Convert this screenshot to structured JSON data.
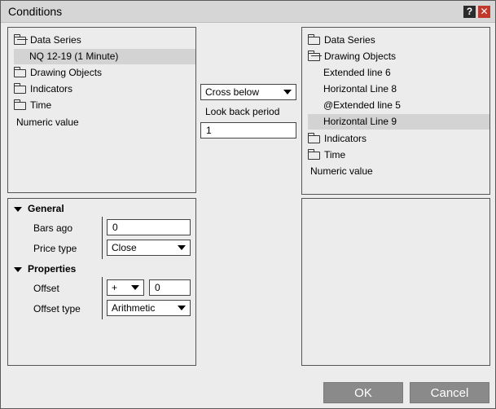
{
  "window": {
    "title": "Conditions",
    "help_label": "?",
    "close_label": "✕"
  },
  "left_tree": {
    "data_series": "Data Series",
    "instrument": "NQ 12-19 (1 Minute)",
    "drawing_objects": "Drawing Objects",
    "indicators": "Indicators",
    "time": "Time",
    "numeric_value": "Numeric value"
  },
  "middle": {
    "operator": "Cross below",
    "lookback_label": "Look back period",
    "lookback_value": "1"
  },
  "right_tree": {
    "data_series": "Data Series",
    "drawing_objects": "Drawing Objects",
    "drawing_children": [
      "Extended line 6",
      "Horizontal Line 8",
      "@Extended line 5",
      "Horizontal Line 9"
    ],
    "selected_child": "Horizontal Line 9",
    "indicators": "Indicators",
    "time": "Time",
    "numeric_value": "Numeric value"
  },
  "properties": {
    "general_label": "General",
    "bars_ago_label": "Bars ago",
    "bars_ago_value": "0",
    "price_type_label": "Price type",
    "price_type_value": "Close",
    "properties_label": "Properties",
    "offset_label": "Offset",
    "offset_sign": "+",
    "offset_value": "0",
    "offset_type_label": "Offset type",
    "offset_type_value": "Arithmetic"
  },
  "buttons": {
    "ok": "OK",
    "cancel": "Cancel"
  },
  "colors": {
    "close_red": "#c0392b",
    "button_gray": "#8a8a8a",
    "selected_row": "#d3d3d3"
  }
}
